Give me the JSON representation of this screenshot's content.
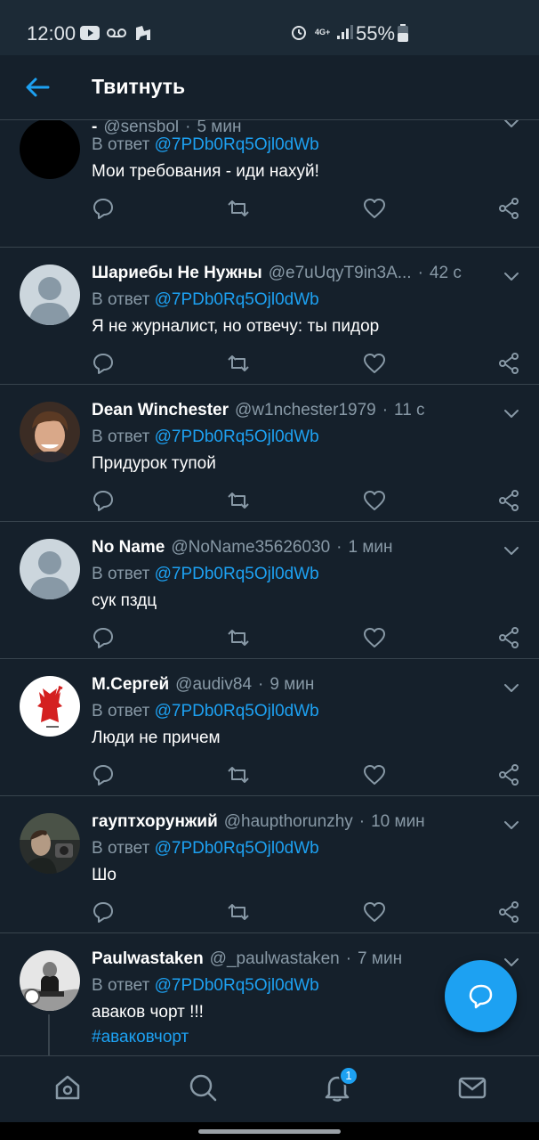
{
  "status_bar": {
    "time": "12:00",
    "battery": "55%",
    "network": "4G+",
    "left_icons": [
      "youtube-icon",
      "voicemail-icon",
      "wifi-calling-icon"
    ],
    "right_icons": [
      "alarm-icon",
      "data-icon",
      "signal-icon",
      "battery-icon"
    ]
  },
  "header": {
    "title": "Твитнуть",
    "back_icon": "arrow-left-icon"
  },
  "tweets": [
    {
      "name": "-",
      "handle": "@sensbol",
      "time": "5 мин",
      "reply_prefix": "В ответ",
      "reply_to": "@7PDb0Rq5Ojl0dWb",
      "text": "Мои требования - иди нахуй!",
      "avatar": "black"
    },
    {
      "name": "Шариебы Не Нужны",
      "handle": "@e7uUqyT9in3A...",
      "time": "42 с",
      "reply_prefix": "В ответ",
      "reply_to": "@7PDb0Rq5Ojl0dWb",
      "text": "Я не журналист, но отвечу: ты пидор",
      "avatar": "default"
    },
    {
      "name": "Dean Winchester",
      "handle": "@w1nchester1979",
      "time": "11 с",
      "reply_prefix": "В ответ",
      "reply_to": "@7PDb0Rq5Ojl0dWb",
      "text": "Придурок тупой",
      "avatar": "photo"
    },
    {
      "name": "No Name",
      "handle": "@NoName35626030",
      "time": "1 мин",
      "reply_prefix": "В ответ",
      "reply_to": "@7PDb0Rq5Ojl0dWb",
      "text": "сук пздц",
      "avatar": "default"
    },
    {
      "name": "М.Сергей",
      "handle": "@audiv84",
      "time": "9 мин",
      "reply_prefix": "В ответ",
      "reply_to": "@7PDb0Rq5Ojl0dWb",
      "text": "Люди не причем",
      "avatar": "red-devil"
    },
    {
      "name": "гауптхорунжий",
      "handle": "@haupthorunzhy",
      "time": "10 мин",
      "reply_prefix": "В ответ",
      "reply_to": "@7PDb0Rq5Ojl0dWb",
      "text": "Шо",
      "avatar": "photo-dark"
    },
    {
      "name": "Paulwastaken",
      "handle": "@_paulwastaken",
      "time": "7 мин",
      "reply_prefix": "В ответ",
      "reply_to": "@7PDb0Rq5Ojl0dWb",
      "text": "аваков чорт !!!",
      "hashtag": "#аваковчорт",
      "avatar": "photo-bw"
    }
  ],
  "actions": [
    "reply-icon",
    "retweet-icon",
    "like-icon",
    "share-icon"
  ],
  "fab": {
    "icon": "compose-message-icon"
  },
  "bottom_nav": {
    "items": [
      "home-icon",
      "search-icon",
      "notifications-icon",
      "messages-icon"
    ],
    "notification_badge": "1"
  },
  "colors": {
    "background": "#15202b",
    "accent": "#1da1f2",
    "secondary_text": "#8899a6",
    "divider": "#38444d"
  }
}
